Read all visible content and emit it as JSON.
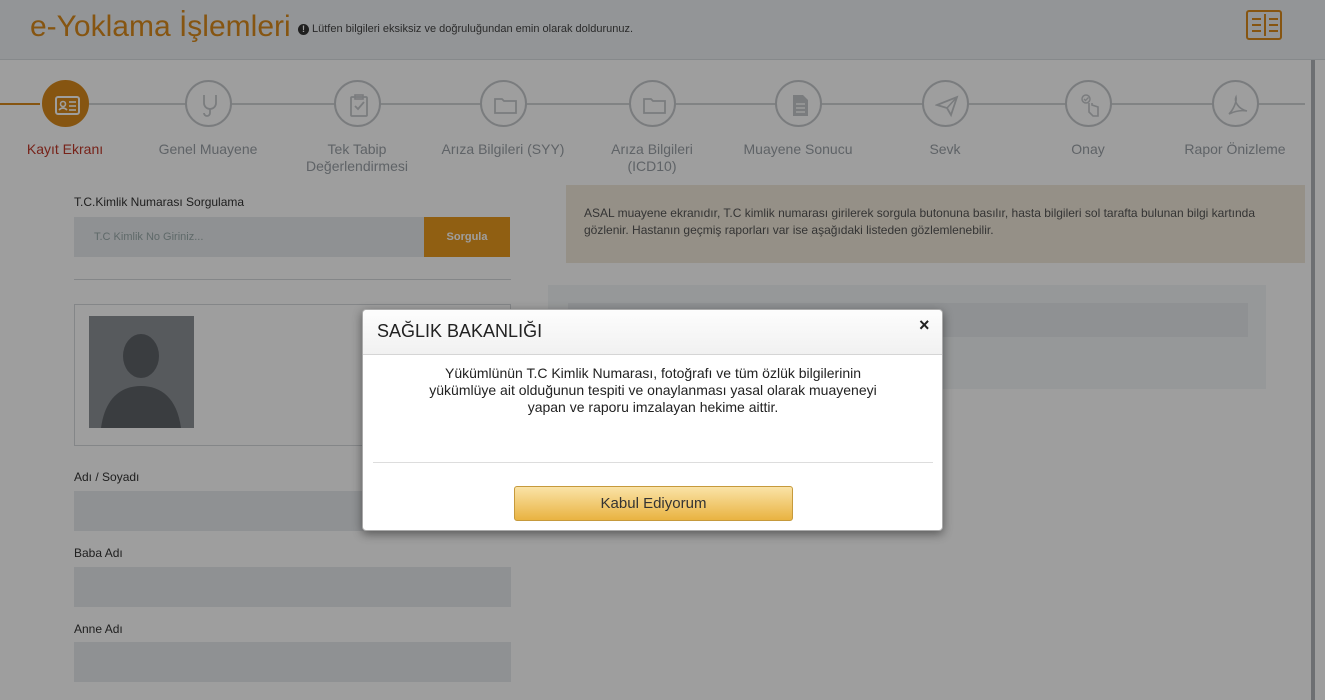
{
  "header": {
    "title": "e-Yoklama İşlemleri",
    "note": "Lütfen bilgileri eksiksiz ve doğruluğundan emin olarak doldurunuz."
  },
  "steps": [
    {
      "label": "Kayıt Ekranı",
      "icon": "id-card-icon",
      "active": true
    },
    {
      "label": "Genel Muayene",
      "icon": "stethoscope-icon",
      "active": false
    },
    {
      "label": "Tek Tabip\nDeğerlendirmesi",
      "icon": "clipboard-icon",
      "active": false
    },
    {
      "label": "Arıza Bilgileri (SYY)",
      "icon": "folder-icon",
      "active": false
    },
    {
      "label": "Arıza Bilgileri\n(ICD10)",
      "icon": "folder-icon",
      "active": false
    },
    {
      "label": "Muayene Sonucu",
      "icon": "document-icon",
      "active": false
    },
    {
      "label": "Sevk",
      "icon": "paper-plane-icon",
      "active": false
    },
    {
      "label": "Onay",
      "icon": "hand-check-icon",
      "active": false
    },
    {
      "label": "Rapor Önizleme",
      "icon": "pdf-icon",
      "active": false
    }
  ],
  "form": {
    "tc_query_label": "T.C.Kimlik Numarası Sorgulama",
    "tc_placeholder": "T.C Kimlik No Giriniz...",
    "query_button": "Sorgula",
    "name_label": "Adı / Soyadı",
    "father_label": "Baba Adı",
    "mother_label": "Anne Adı"
  },
  "info": {
    "text": "ASAL muayene ekranıdır, T.C kimlik numarası girilerek sorgula butonuna basılır, hasta bilgileri sol tarafta bulunan bilgi kartında gözlenir. Hastanın geçmiş raporları var ise aşağıdaki listeden gözlemlenebilir."
  },
  "modal": {
    "title": "SAĞLIK BAKANLIĞI",
    "close": "×",
    "body_line1": "Yükümlünün T.C Kimlik Numarası, fotoğrafı ve tüm özlük bilgilerinin",
    "body_line2": "yükümlüye ait olduğunun tespiti ve onaylanması yasal olarak muayeneyi",
    "body_line3": "yapan ve raporu imzalayan hekime aittir.",
    "accept_button": "Kabul Ediyorum"
  },
  "colors": {
    "accent": "#d88a1c",
    "active_label": "#c0392b",
    "button": "#e8991e"
  }
}
